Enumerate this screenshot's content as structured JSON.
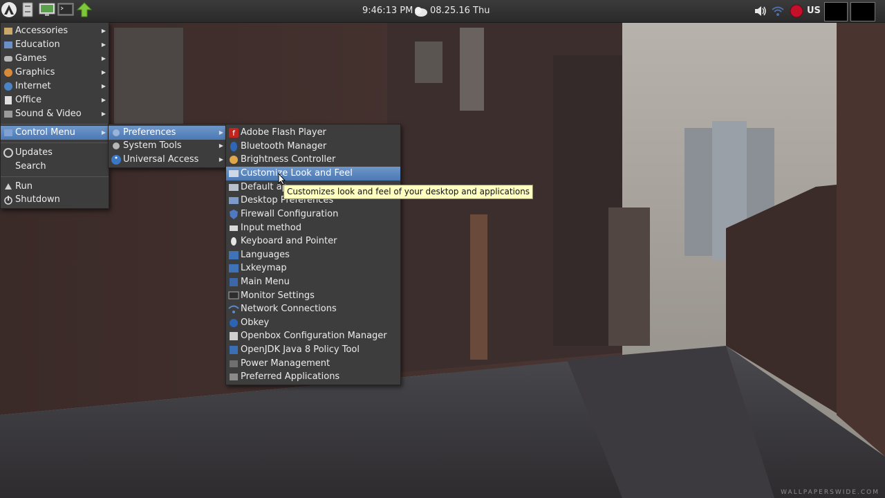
{
  "panel": {
    "time": "9:46:13 PM",
    "date": "08.25.16 Thu",
    "keyboard_layout": "US"
  },
  "main_menu": {
    "items": [
      {
        "label": "Accessories",
        "icon": "accessories-icon"
      },
      {
        "label": "Education",
        "icon": "education-icon"
      },
      {
        "label": "Games",
        "icon": "games-icon"
      },
      {
        "label": "Graphics",
        "icon": "graphics-icon"
      },
      {
        "label": "Internet",
        "icon": "internet-icon"
      },
      {
        "label": "Office",
        "icon": "office-icon"
      },
      {
        "label": "Sound & Video",
        "icon": "sound-video-icon"
      },
      {
        "label": "Control Menu",
        "icon": "control-menu-icon"
      },
      {
        "label": "Updates",
        "icon": "updates-icon"
      },
      {
        "label": "Search",
        "icon": "search-icon"
      },
      {
        "label": "Run",
        "icon": "run-icon"
      },
      {
        "label": "Shutdown",
        "icon": "power-icon"
      }
    ]
  },
  "control_menu": {
    "items": [
      {
        "label": "Preferences",
        "icon": "preferences-icon"
      },
      {
        "label": "System Tools",
        "icon": "system-tools-icon"
      },
      {
        "label": "Universal Access",
        "icon": "accessibility-icon"
      }
    ]
  },
  "preferences_menu": {
    "items": [
      {
        "label": "Adobe Flash Player",
        "icon": "flash-icon"
      },
      {
        "label": "Bluetooth Manager",
        "icon": "bluetooth-icon"
      },
      {
        "label": "Brightness Controller",
        "icon": "brightness-icon"
      },
      {
        "label": "Customize Look and Feel",
        "icon": "appearance-icon"
      },
      {
        "label": "Default ap",
        "icon": "default-apps-icon"
      },
      {
        "label": "Desktop Preferences",
        "icon": "desktop-icon"
      },
      {
        "label": "Firewall Configuration",
        "icon": "firewall-icon"
      },
      {
        "label": "Input method",
        "icon": "input-method-icon"
      },
      {
        "label": "Keyboard and Pointer",
        "icon": "keyboard-mouse-icon"
      },
      {
        "label": "Languages",
        "icon": "languages-icon"
      },
      {
        "label": "Lxkeymap",
        "icon": "keymap-icon"
      },
      {
        "label": "Main Menu",
        "icon": "main-menu-icon"
      },
      {
        "label": "Monitor Settings",
        "icon": "monitor-icon"
      },
      {
        "label": "Network Connections",
        "icon": "network-icon"
      },
      {
        "label": "Obkey",
        "icon": "obkey-icon"
      },
      {
        "label": "Openbox Configuration Manager",
        "icon": "openbox-icon"
      },
      {
        "label": "OpenJDK Java 8 Policy Tool",
        "icon": "java-icon"
      },
      {
        "label": "Power Management",
        "icon": "power-management-icon"
      },
      {
        "label": "Preferred Applications",
        "icon": "preferred-apps-icon"
      }
    ]
  },
  "tooltip": "Customizes look and feel of your desktop and applications",
  "watermark": "WALLPAPERSWIDE.COM",
  "colors": {
    "panel": "#2f2f2f",
    "menu_bg": "#3d3d3d",
    "selection": "#5a86be",
    "tooltip_bg": "#ffffbf"
  }
}
